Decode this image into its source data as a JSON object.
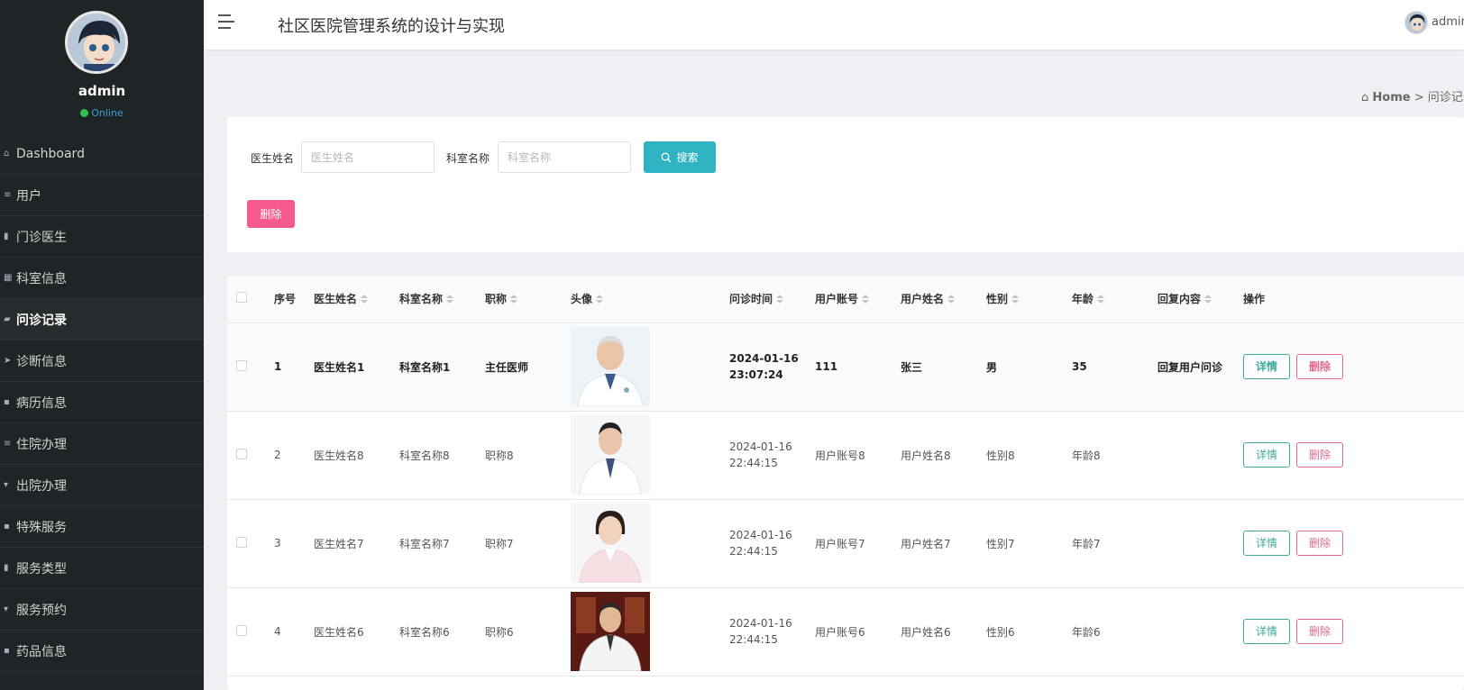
{
  "sidebar": {
    "username": "admin",
    "status": "Online",
    "items": [
      {
        "label": "Dashboard",
        "icon": "home-icon"
      },
      {
        "label": "用户",
        "icon": "sliders-icon"
      },
      {
        "label": "门诊医生",
        "icon": "chart-icon"
      },
      {
        "label": "科室信息",
        "icon": "grid-icon"
      },
      {
        "label": "问诊记录",
        "icon": "clipboard-icon"
      },
      {
        "label": "诊断信息",
        "icon": "send-icon"
      },
      {
        "label": "病历信息",
        "icon": "grid-icon"
      },
      {
        "label": "住院办理",
        "icon": "list-icon"
      },
      {
        "label": "出院办理",
        "icon": "tag-icon"
      },
      {
        "label": "特殊服务",
        "icon": "clipboard-icon"
      },
      {
        "label": "服务类型",
        "icon": "bar-icon"
      },
      {
        "label": "服务预约",
        "icon": "tag-icon"
      },
      {
        "label": "药品信息",
        "icon": "grid-icon"
      }
    ]
  },
  "header": {
    "title": "社区医院管理系统的设计与实现",
    "user": "admin"
  },
  "breadcrumb": {
    "home": "Home",
    "separator": ">",
    "current": "问诊记录"
  },
  "search": {
    "doctor_label": "医生姓名",
    "doctor_placeholder": "医生姓名",
    "dept_label": "科室名称",
    "dept_placeholder": "科室名称",
    "search_button": "搜索",
    "delete_button": "删除"
  },
  "table": {
    "headers": [
      "序号",
      "医生姓名",
      "科室名称",
      "职称",
      "头像",
      "问诊时间",
      "用户账号",
      "用户姓名",
      "性别",
      "年龄",
      "回复内容",
      "操作"
    ],
    "detail_label": "详情",
    "delete_label": "删除",
    "rows": [
      {
        "idx": "1",
        "doctor": "医生姓名1",
        "dept": "科室名称1",
        "title": "主任医师",
        "date": "2024-01-16",
        "time": "23:07:24",
        "account": "111",
        "uname": "张三",
        "gender": "男",
        "age": "35",
        "reply": "回复用户问诊"
      },
      {
        "idx": "2",
        "doctor": "医生姓名8",
        "dept": "科室名称8",
        "title": "职称8",
        "date": "2024-01-16",
        "time": "22:44:15",
        "account": "用户账号8",
        "uname": "用户姓名8",
        "gender": "性别8",
        "age": "年龄8",
        "reply": ""
      },
      {
        "idx": "3",
        "doctor": "医生姓名7",
        "dept": "科室名称7",
        "title": "职称7",
        "date": "2024-01-16",
        "time": "22:44:15",
        "account": "用户账号7",
        "uname": "用户姓名7",
        "gender": "性别7",
        "age": "年龄7",
        "reply": ""
      },
      {
        "idx": "4",
        "doctor": "医生姓名6",
        "dept": "科室名称6",
        "title": "职称6",
        "date": "2024-01-16",
        "time": "22:44:15",
        "account": "用户账号6",
        "uname": "用户姓名6",
        "gender": "性别6",
        "age": "年龄6",
        "reply": ""
      }
    ]
  },
  "colors": {
    "sidebar_bg": "#1f2426",
    "search_button": "#2fb2c1",
    "delete_button": "#f45b8c",
    "detail_outline": "#3fa99a",
    "delete_outline": "#e2688e"
  }
}
